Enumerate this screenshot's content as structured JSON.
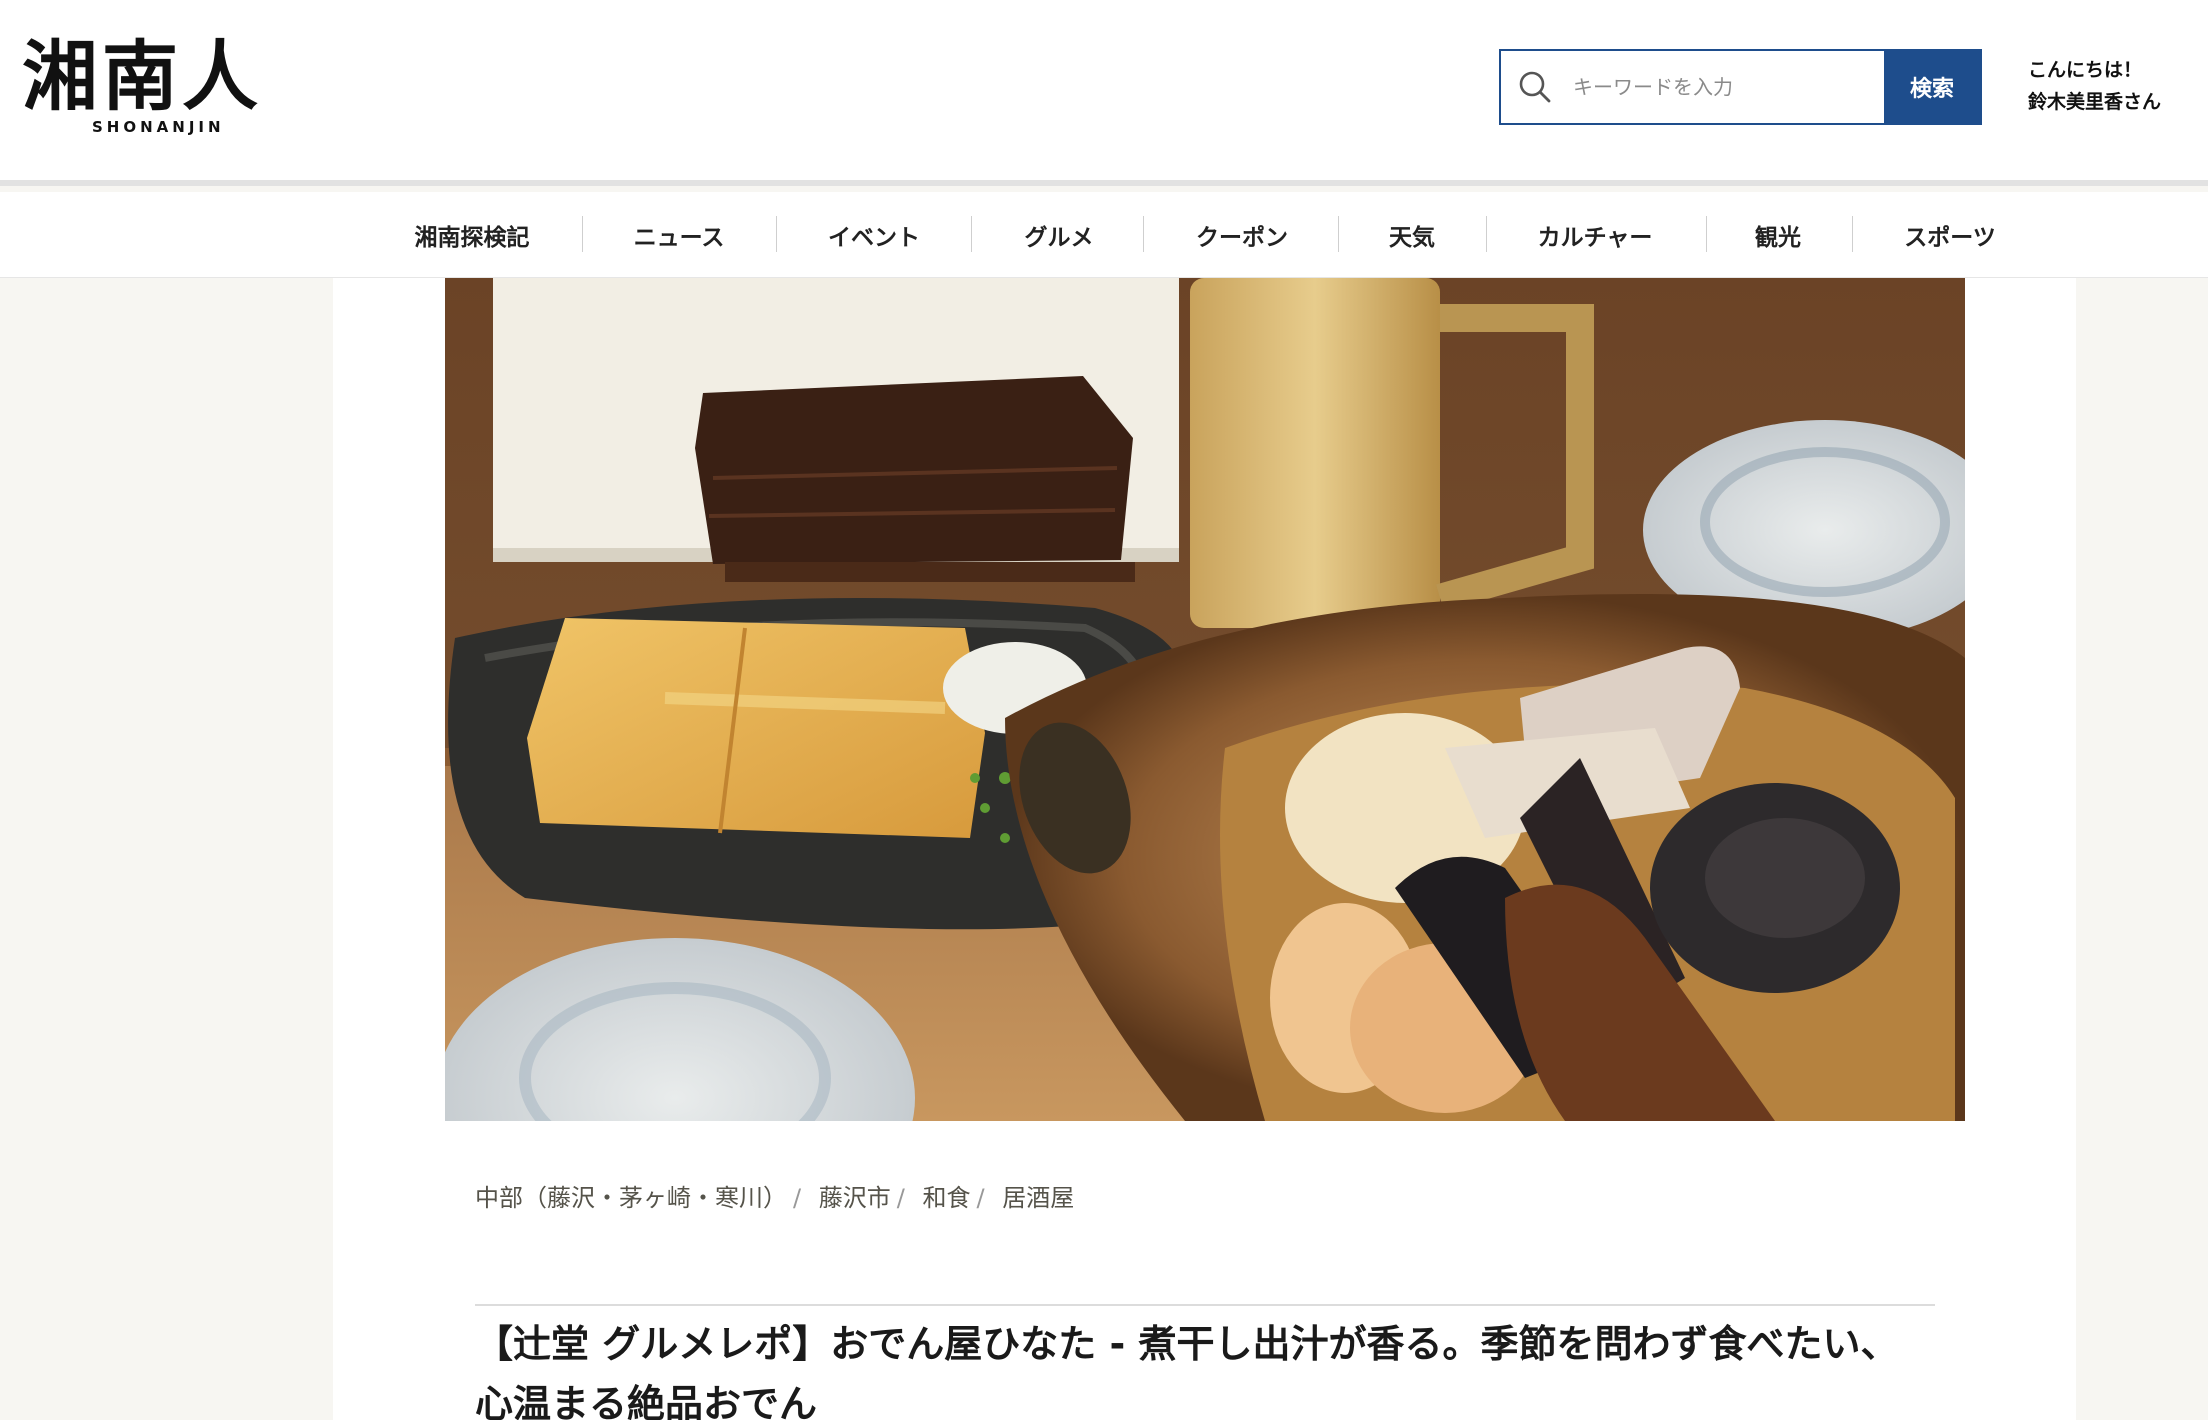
{
  "header": {
    "logo_text": "湘南人",
    "logo_sub": "SHONANJIN",
    "search": {
      "placeholder": "キーワードを入力",
      "button_label": "検索"
    },
    "greeting_line1": "こんにちは！",
    "greeting_line2": "鈴木美里香さん"
  },
  "nav": {
    "items": [
      {
        "label": "湘南探検記"
      },
      {
        "label": "ニュース"
      },
      {
        "label": "イベント"
      },
      {
        "label": "グルメ"
      },
      {
        "label": "クーポン"
      },
      {
        "label": "天気"
      },
      {
        "label": "カルチャー"
      },
      {
        "label": "観光"
      },
      {
        "label": "スポーツ"
      }
    ]
  },
  "article": {
    "hero_image": "food-photo",
    "breadcrumb": [
      {
        "label": "中部（藤沢・茅ヶ崎・寒川）"
      },
      {
        "label": "藤沢市"
      },
      {
        "label": "和食"
      },
      {
        "label": "居酒屋"
      }
    ],
    "title": "【辻堂 グルメレポ】おでん屋ひなた - 煮干し出汁が香る。季節を問わず食べたい、心温まる絶品おでん"
  },
  "icons": {
    "search": "search-icon"
  },
  "colors": {
    "accent": "#1e4d8c",
    "page_bg": "#f7f6f2"
  }
}
